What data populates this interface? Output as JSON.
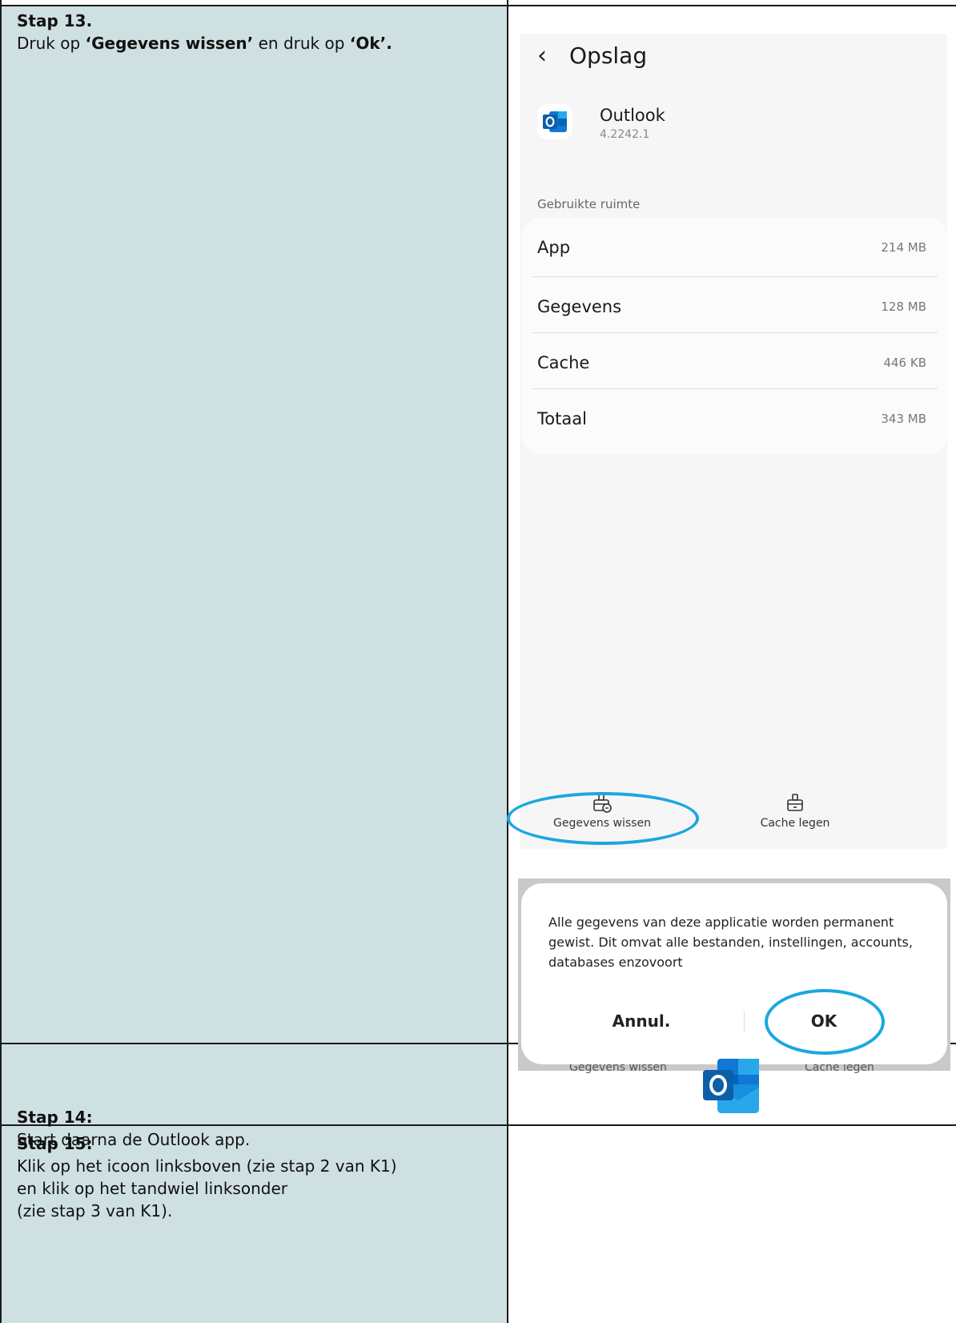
{
  "steps": [
    {
      "title": "Stap 13.",
      "text_pre": "Druk op ",
      "text_bold1": "‘Gegevens wissen’",
      "text_mid": " en druk op ",
      "text_bold2": "‘Ok’."
    },
    {
      "title": "Stap 14:",
      "text": "Start daarna de Outlook app."
    },
    {
      "title": "Stap 15:",
      "lines": [
        "Klik op het icoon linksboven (zie stap 2 van K1)",
        "en klik op het tandwiel linksonder",
        "(zie stap 3 van K1)."
      ]
    }
  ],
  "phone": {
    "back_icon": "‹",
    "title": "Opslag",
    "app_name": "Outlook",
    "app_version": "4.2242.1",
    "section_label": "Gebruikte ruimte",
    "rows": [
      {
        "label": "App",
        "value": "214 MB"
      },
      {
        "label": "Gegevens",
        "value": "128 MB"
      },
      {
        "label": "Cache",
        "value": "446  KB"
      },
      {
        "label": "Totaal",
        "value": "343 MB"
      }
    ],
    "actions": [
      {
        "label": "Gegevens wissen",
        "icon": "clear-data-icon"
      },
      {
        "label": "Cache legen",
        "icon": "clear-cache-icon"
      }
    ],
    "highlight_color": "#1ba7e0"
  },
  "dialog": {
    "message": "Alle gegevens van deze applicatie worden permanent gewist. Dit omvat alle bestanden, instellingen, accounts, databases enzovoort",
    "cancel_label": "Annul.",
    "ok_label": "OK",
    "behind_left": "Gegevens wissen",
    "behind_right": "Cache legen"
  },
  "colors": {
    "left_cell_bg": "#cfe0e2",
    "outlook_blue": "#0f78d4"
  }
}
